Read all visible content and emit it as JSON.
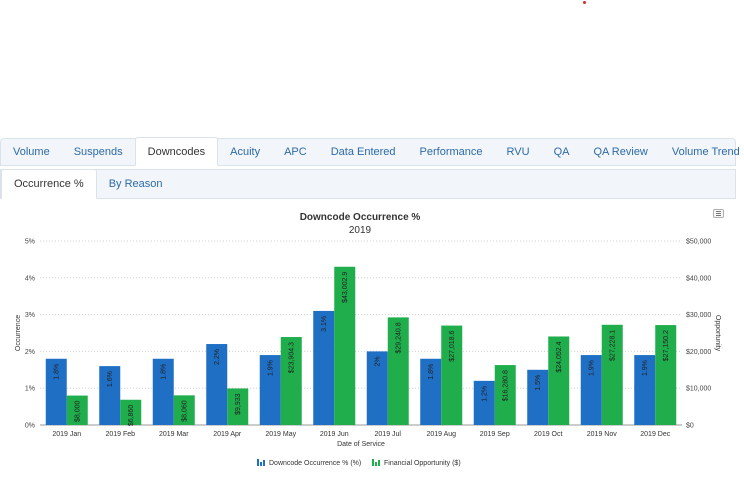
{
  "main_tabs": [
    "Volume",
    "Suspends",
    "Downcodes",
    "Acuity",
    "APC",
    "Data Entered",
    "Performance",
    "RVU",
    "QA",
    "QA Review",
    "Volume Trend"
  ],
  "main_active": 2,
  "sub_tabs": [
    "Occurrence %",
    "By Reason"
  ],
  "sub_active": 0,
  "colors": {
    "series1": "#1f6fc5",
    "series2": "#20ad4c",
    "tab_link": "#2d6aa8"
  },
  "icons": {
    "menu": "hamburger-menu-icon"
  },
  "chart_data": {
    "type": "bar",
    "title": "Downcode Occurrence %",
    "subtitle": "2019",
    "xlabel": "Date of Service",
    "ylabel_left": "Occurrence",
    "ylabel_right": "Opportunity",
    "categories": [
      "2019 Jan",
      "2019 Feb",
      "2019 Mar",
      "2019 Apr",
      "2019 May",
      "2019 Jun",
      "2019 Jul",
      "2019 Aug",
      "2019 Sep",
      "2019 Oct",
      "2019 Nov",
      "2019 Dec"
    ],
    "y_left": {
      "ticks": [
        "0%",
        "1%",
        "2%",
        "3%",
        "4%",
        "5%"
      ],
      "ylim": [
        0,
        5
      ]
    },
    "y_right": {
      "ticks": [
        "$0",
        "$10,000",
        "$20,000",
        "$30,000",
        "$40,000",
        "$50,000"
      ],
      "ylim": [
        0,
        50000
      ]
    },
    "grid": true,
    "legend_position": "bottom-center",
    "series": [
      {
        "name": "Downcode Occurrence % (%)",
        "axis": "left",
        "values": [
          1.8,
          1.6,
          1.8,
          2.2,
          1.9,
          3.1,
          2.0,
          1.8,
          1.2,
          1.5,
          1.9,
          1.9
        ],
        "labels": [
          "1.8%",
          "1.6%",
          "1.8%",
          "2.2%",
          "1.9%",
          "3.1%",
          "2%",
          "1.8%",
          "1.2%",
          "1.5%",
          "1.9%",
          "1.9%"
        ]
      },
      {
        "name": "Financial Opportunity ($)",
        "axis": "right",
        "values": [
          8000,
          6860,
          8060,
          9933,
          23904.3,
          43002.9,
          29240.8,
          27018.6,
          16280.8,
          24052.4,
          27228.1,
          27150.2
        ],
        "labels": [
          "$8,000",
          "$6,860",
          "$8,060",
          "$9,933",
          "$23,904.3",
          "$43,002.9",
          "$29,240.8",
          "$27,018.6",
          "$16,280.8",
          "$24,052.4",
          "$27,228.1",
          "$27,150.2"
        ]
      }
    ]
  }
}
